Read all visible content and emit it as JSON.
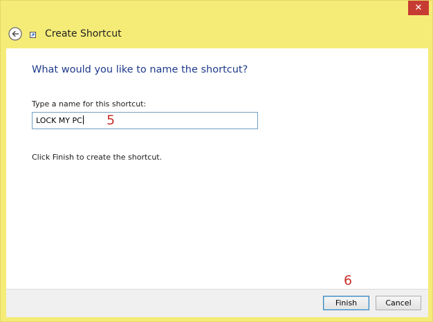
{
  "window": {
    "close_glyph": "✕"
  },
  "header": {
    "title": "Create Shortcut",
    "back_icon": "back-arrow-icon",
    "app_icon": "shortcut-icon"
  },
  "main": {
    "heading": "What would you like to name the shortcut?",
    "name_label": "Type a name for this shortcut:",
    "name_value": "LOCK MY PC",
    "hint": "Click Finish to create the shortcut."
  },
  "annotations": {
    "step_5": "5",
    "step_6": "6"
  },
  "footer": {
    "finish_label": "Finish",
    "cancel_label": "Cancel"
  },
  "colors": {
    "window_frame": "#f5ec78",
    "heading": "#1e3a8a",
    "close_button": "#c73c32",
    "annotation": "#c8302b",
    "input_border": "#6f9ec2"
  }
}
